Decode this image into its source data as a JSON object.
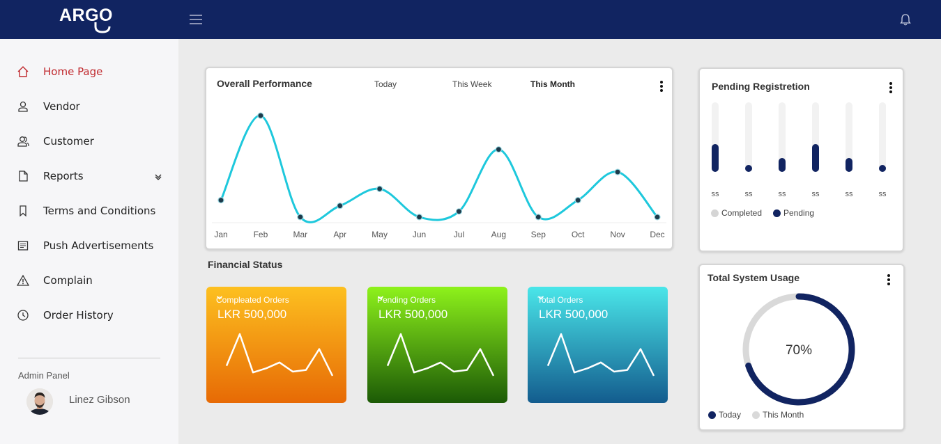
{
  "brand": {
    "name": "ARGO"
  },
  "sidebar": {
    "items": [
      {
        "label": "Home Page",
        "icon": "home-icon",
        "active": true
      },
      {
        "label": "Vendor",
        "icon": "user-icon"
      },
      {
        "label": "Customer",
        "icon": "users-icon"
      },
      {
        "label": "Reports",
        "icon": "document-icon",
        "has_submenu": true
      },
      {
        "label": "Terms and Conditions",
        "icon": "bookmark-icon"
      },
      {
        "label": "Push Advertisements",
        "icon": "newspaper-icon"
      },
      {
        "label": "Complain",
        "icon": "warning-icon"
      },
      {
        "label": "Order History",
        "icon": "clock-icon"
      }
    ],
    "admin_label": "Admin Panel",
    "user_name": "Linez Gibson"
  },
  "performance": {
    "title": "Overall Performance",
    "tabs": [
      "Today",
      "This Week",
      "This Month"
    ],
    "active_tab": "This Month"
  },
  "chart_data": [
    {
      "type": "line",
      "title": "Overall Performance",
      "categories": [
        "Jan",
        "Feb",
        "Mar",
        "Apr",
        "May",
        "Jun",
        "Jul",
        "Aug",
        "Sep",
        "Oct",
        "Nov",
        "Dec"
      ],
      "series": [
        {
          "values": [
            20,
            95,
            5,
            15,
            30,
            5,
            10,
            65,
            5,
            20,
            45,
            5
          ]
        }
      ],
      "ylim": [
        0,
        100
      ],
      "grid": false,
      "color": "#1ec8dc"
    },
    {
      "type": "bar",
      "title": "Pending Registretion",
      "categories": [
        "ss",
        "ss",
        "ss",
        "ss",
        "ss",
        "ss"
      ],
      "series": [
        {
          "name": "Completed",
          "values": [
            100,
            100,
            100,
            100,
            100,
            100
          ]
        },
        {
          "name": "Pending",
          "values": [
            40,
            10,
            20,
            40,
            20,
            10
          ]
        }
      ],
      "ylim": [
        0,
        100
      ],
      "colors": {
        "Completed": "#d5d5d5",
        "Pending": "#112461"
      }
    },
    {
      "type": "pie",
      "title": "Total System Usage",
      "categories": [
        "Today",
        "This Month"
      ],
      "values": [
        70,
        30
      ],
      "center_label": "70%",
      "colors": {
        "Today": "#112461",
        "This Month": "#d9d9d9"
      }
    }
  ],
  "financial": {
    "title": "Financial Status",
    "cards": [
      {
        "label": "Compleated Orders",
        "value": "LKR 500,000",
        "spark": [
          12,
          50,
          4,
          9,
          16,
          5,
          7,
          32,
          0
        ]
      },
      {
        "label": "Pending Orders",
        "value": "LKR 500,000",
        "spark": [
          12,
          50,
          4,
          9,
          16,
          5,
          7,
          32,
          0
        ]
      },
      {
        "label": "Total Orders",
        "value": "LKR 500,000",
        "spark": [
          12,
          50,
          4,
          9,
          16,
          5,
          7,
          32,
          0
        ]
      }
    ]
  },
  "pending": {
    "title": "Pending Registretion",
    "legend": [
      "Completed",
      "Pending"
    ]
  },
  "usage": {
    "title": "Total System Usage",
    "center": "70%",
    "legend": [
      "Today",
      "This Month"
    ]
  }
}
